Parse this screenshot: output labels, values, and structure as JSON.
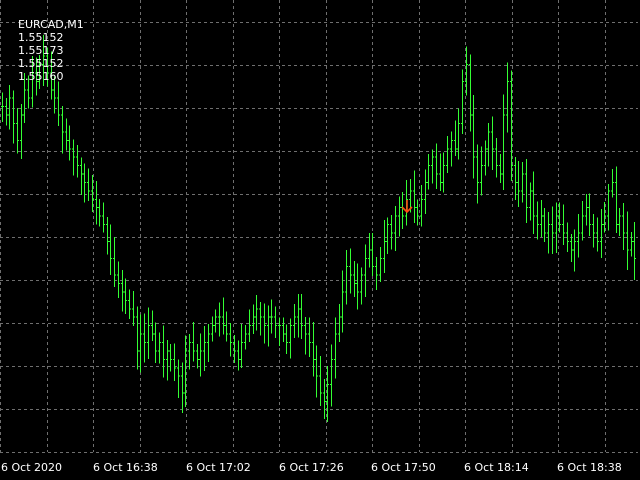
{
  "header": {
    "symbol_timeframe": "EURCAD,M1",
    "open": "1.55152",
    "high": "1.55173",
    "low": "1.55152",
    "close": "1.55160"
  },
  "colors": {
    "background": "#000000",
    "bar": "#33ff33",
    "grid": "#6f6f6f",
    "text": "#ffffff",
    "sell_arrow": "#ff4a12"
  },
  "chart_data": {
    "type": "bar",
    "style": "OHLC bars",
    "grid": true,
    "x_tick_labels": [
      "6 Oct 2020",
      "6 Oct 16:38",
      "6 Oct 17:02",
      "6 Oct 17:26",
      "6 Oct 17:50",
      "6 Oct 18:14",
      "6 Oct 18:38"
    ],
    "price_range": [
      1.5484,
      1.5536
    ],
    "signal": {
      "type": "sell-arrow",
      "near": "6 Oct 17:50"
    },
    "closes": [
      1.5525,
      1.5524,
      1.5526,
      1.5523,
      1.5521,
      1.5524,
      1.5527,
      1.5526,
      1.5529,
      1.5528,
      1.553,
      1.5531,
      1.5529,
      1.5527,
      1.5526,
      1.5524,
      1.5522,
      1.5521,
      1.552,
      1.5519,
      1.5518,
      1.5517,
      1.5516,
      1.5515,
      1.5514,
      1.5513,
      1.5512,
      1.5511,
      1.5509,
      1.5507,
      1.5505,
      1.5504,
      1.5503,
      1.5502,
      1.5501,
      1.55,
      1.5496,
      1.5498,
      1.5497,
      1.5499,
      1.5498,
      1.5496,
      1.5497,
      1.5495,
      1.5496,
      1.5495,
      1.5494,
      1.5493,
      1.5491,
      1.5496,
      1.5497,
      1.5496,
      1.5495,
      1.5496,
      1.5497,
      1.5498,
      1.5499,
      1.55,
      1.55,
      1.5499,
      1.5498,
      1.5497,
      1.5496,
      1.5495,
      1.5497,
      1.5498,
      1.5499,
      1.55,
      1.5501,
      1.55,
      1.5499,
      1.55,
      1.55,
      1.5499,
      1.5499,
      1.5498,
      1.5497,
      1.5499,
      1.55,
      1.5501,
      1.5499,
      1.5498,
      1.5497,
      1.5495,
      1.5493,
      1.5491,
      1.549,
      1.5492,
      1.5495,
      1.5498,
      1.55,
      1.5503,
      1.5506,
      1.5505,
      1.5504,
      1.5503,
      1.5505,
      1.5507,
      1.5508,
      1.5506,
      1.5505,
      1.5507,
      1.5509,
      1.5511,
      1.551,
      1.5512,
      1.5513,
      1.5512,
      1.5514,
      1.5515,
      1.5513,
      1.5512,
      1.5514,
      1.5516,
      1.5518,
      1.5519,
      1.5517,
      1.5516,
      1.5518,
      1.552,
      1.5521,
      1.552,
      1.5523,
      1.5528,
      1.553,
      1.5524,
      1.5519,
      1.5516,
      1.5518,
      1.552,
      1.5522,
      1.552,
      1.5518,
      1.5517,
      1.5524,
      1.5528,
      1.5518,
      1.5516,
      1.5515,
      1.5517,
      1.5513,
      1.5515,
      1.5512,
      1.5511,
      1.5512,
      1.551,
      1.5511,
      1.551,
      1.5512,
      1.5511,
      1.551,
      1.5509,
      1.5508,
      1.5509,
      1.551,
      1.5512,
      1.5513,
      1.5511,
      1.551,
      1.5509,
      1.5511,
      1.5512,
      1.5515,
      1.5516,
      1.5511,
      1.5512,
      1.551,
      1.5508,
      1.5509,
      1.5507
    ]
  }
}
